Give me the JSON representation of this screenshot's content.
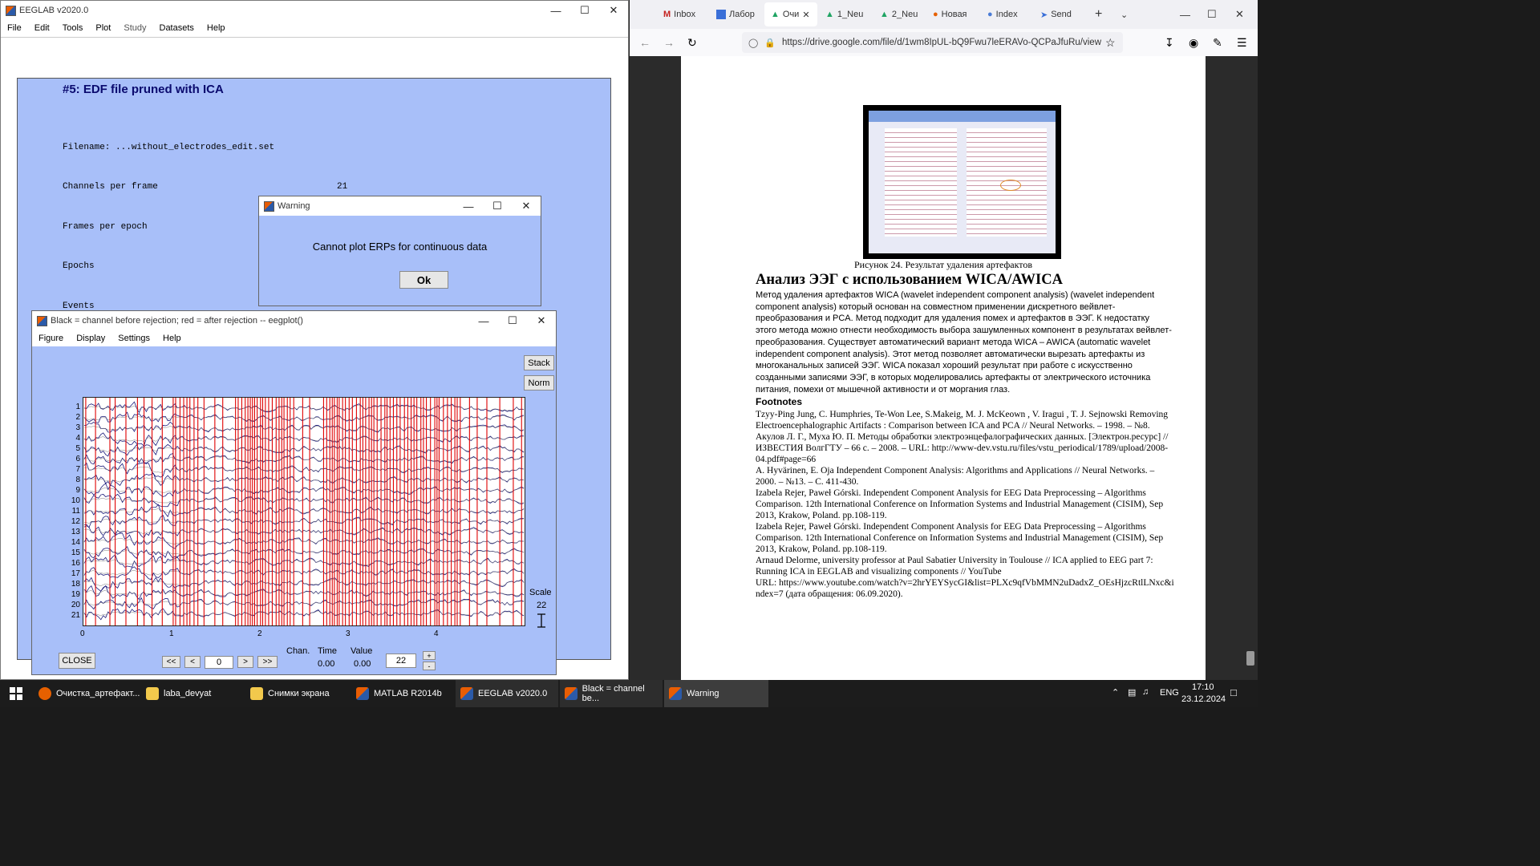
{
  "eeglab": {
    "title": "EEGLAB v2020.0",
    "menus": [
      "File",
      "Edit",
      "Tools",
      "Plot",
      "Study",
      "Datasets",
      "Help"
    ],
    "heading": "#5: EDF file pruned with ICA",
    "rows": [
      {
        "label": "Filename: ...without_electrodes_edit.set",
        "value": ""
      },
      {
        "label": "Channels per frame",
        "value": "21"
      },
      {
        "label": "Frames per epoch",
        "value": ""
      },
      {
        "label": "Epochs",
        "value": ""
      },
      {
        "label": "Events",
        "value": ""
      }
    ]
  },
  "warning": {
    "title": "Warning",
    "message": "Cannot plot ERPs for continuous data",
    "ok": "Ok"
  },
  "eegplot": {
    "title": "Black = channel before rejection; red = after rejection -- eegplot()",
    "menus": [
      "Figure",
      "Display",
      "Settings",
      "Help"
    ],
    "stack": "Stack",
    "norm": "Norm",
    "channels": [
      "1",
      "2",
      "3",
      "4",
      "5",
      "6",
      "7",
      "8",
      "9",
      "10",
      "11",
      "12",
      "13",
      "14",
      "15",
      "16",
      "17",
      "18",
      "19",
      "20",
      "21"
    ],
    "xticks": [
      "0",
      "1",
      "2",
      "3",
      "4"
    ],
    "scale_label": "Scale",
    "scale_value": "22",
    "close": "CLOSE",
    "nav": [
      "<<",
      "<",
      ">",
      ">>"
    ],
    "pos_value": "0",
    "chan_label": "Chan.",
    "time_label": "Time",
    "value_label": "Value",
    "time_value": "0.00",
    "value_value": "0.00",
    "scale_box": "22",
    "plus": "+",
    "minus": "-"
  },
  "browser": {
    "tabs": [
      "Inbox",
      "Лабор",
      "Очи",
      "1_Neu",
      "2_Neu",
      "Новая",
      "Index",
      "Send"
    ],
    "url": "https://drive.google.com/file/d/1wm8IpUL-bQ9Fwu7leERAVo-QCPaJfuRu/view",
    "caption": "Рисунок 24. Результат удаления артефактов",
    "heading": "Анализ ЭЭГ с использованием WICA/AWICA",
    "para": "Метод удаления артефактов WICA (wavelet independent component analysis) (wavelet independent component analysis) который основан на совместном применении дискретного вейвлет-преобразования и PCA. Метод подходит для удаления помех и артефактов в ЭЭГ. К недостатку этого метода можно отнести необходимость выбора зашумленных компонент в результатах вейвлет-преобразования. Существует автоматический вариант метода WICA – AWICA (automatic wavelet independent component analysis). Этот метод позволяет автоматически вырезать артефакты из многоканальных записей ЭЭГ. WICA показал хороший результат при работе с искусственно созданными записями ЭЭГ, в которых моделировались артефакты от электрического источника питания, помехи от мышечной активности и от моргания глаз.",
    "footnotes_title": "Footnotes",
    "refs": [
      "Tzyy-Ping Jung, C. Humphries, Te-Won Lee, S.Makeig, M. J. McKeown , V. Iragui , T. J. Sejnowski Removing Electroencephalographic Artifacts : Comparison between ICA and PCA // Neural Networks. – 1998. – №8.",
      "Акулов Л. Г., Муха Ю. П. Методы обработки электроэнцефалографических данных. [Электрон.ресурс] // ИЗВЕСТИЯ ВолгГТУ – 66 с. – 2008. – URL: http://www-dev.vstu.ru/files/vstu_periodical/1789/upload/2008-04.pdf#page=66",
      "A. Hyvärinen, E. Oja Independent Component Analysis: Algorithms and Applications // Neural Networks. – 2000. – №13. – С. 411-430.",
      "Izabela Rejer, Paweł Górski. Independent Component Analysis for EEG Data Preprocessing – Algorithms Comparison. 12th International Conference on Information Systems and Industrial Management (CISIM), Sep 2013, Krakow, Poland. pp.108-119.",
      "Izabela Rejer, Paweł Górski. Independent Component Analysis for EEG Data Preprocessing – Algorithms Comparison. 12th International Conference on Information Systems and Industrial Management (CISIM), Sep 2013, Krakow, Poland. pp.108-119.",
      "Arnaud Delorme, university professor at Paul Sabatier University in Toulouse // ICA applied to EEG part 7: Running ICA in EEGLAB and visualizing components // YouTube",
      "URL: https://www.youtube.com/watch?v=2hrYEYSycGI&list=PLXc9qfVbMMN2uDadxZ_OEsHjzcRtlLNxc&index=7 (дата обращения: 06.09.2020)."
    ]
  },
  "taskbar": {
    "items": [
      "Очистка_артефакт...",
      "laba_devyat",
      "Снимки экрана",
      "MATLAB R2014b",
      "EEGLAB v2020.0",
      "Black = channel be...",
      "Warning"
    ],
    "lang": "ENG",
    "time": "17:10",
    "date": "23.12.2024"
  }
}
